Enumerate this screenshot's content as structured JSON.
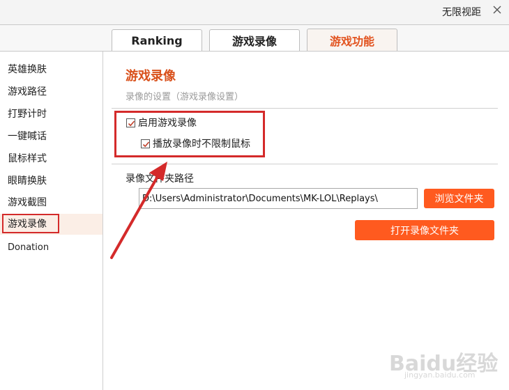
{
  "window": {
    "title": "无限视距",
    "close_glyph": "✕"
  },
  "tabs": [
    {
      "label": "Ranking",
      "active": false
    },
    {
      "label": "游戏录像",
      "active": false
    },
    {
      "label": "游戏功能",
      "active": true
    }
  ],
  "sidebar": {
    "items": [
      {
        "label": "英雄换肤"
      },
      {
        "label": "游戏路径"
      },
      {
        "label": "打野计时"
      },
      {
        "label": "一键喊话"
      },
      {
        "label": "鼠标样式"
      },
      {
        "label": "眼睛换肤"
      },
      {
        "label": "游戏截图"
      },
      {
        "label": "游戏录像",
        "active": true
      },
      {
        "label": "Donation"
      }
    ]
  },
  "main": {
    "title": "游戏录像",
    "subtitle": "录像的设置（游戏录像设置）",
    "checkboxes": [
      {
        "label": "启用游戏录像",
        "checked": true
      },
      {
        "label": "播放录像时不限制鼠标",
        "checked": true
      }
    ],
    "folder_label": "录像文件夹路径",
    "folder_path": "D:\\Users\\Administrator\\Documents\\MK-LOL\\Replays\\",
    "browse_button": "浏览文件夹",
    "open_button": "打开录像文件夹"
  },
  "watermark": {
    "brand": "Baidu经验",
    "url": "jingyan.baidu.com"
  },
  "colors": {
    "accent": "#ff5a1f",
    "title_orange": "#d9511c",
    "highlight_red": "#d42a2a"
  }
}
